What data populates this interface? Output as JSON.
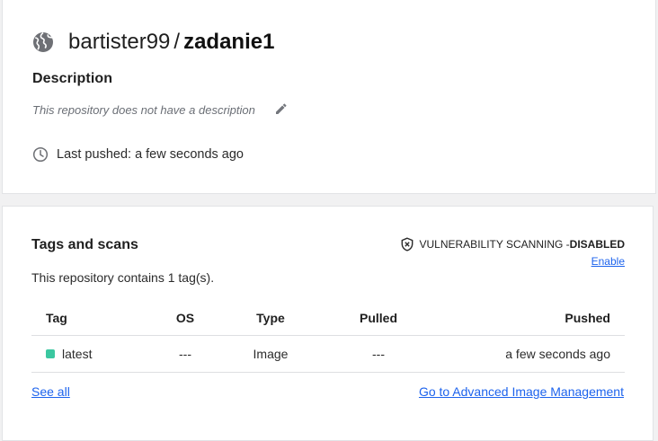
{
  "repo": {
    "owner": "bartister99",
    "separator": "/",
    "name": "zadanie1",
    "icon": "globe-icon"
  },
  "description": {
    "heading": "Description",
    "text": "This repository does not have a description",
    "edit_icon": "pencil-icon"
  },
  "last_pushed": {
    "text": "Last pushed: a few seconds ago",
    "icon": "clock-icon"
  },
  "tags": {
    "heading": "Tags and scans",
    "summary": "This repository contains 1 tag(s).",
    "vulnerability": {
      "label": "VULNERABILITY SCANNING - ",
      "status": "DISABLED",
      "icon": "shield-x-icon",
      "enable_link": "Enable"
    },
    "columns": [
      "Tag",
      "OS",
      "Type",
      "Pulled",
      "Pushed"
    ],
    "rows": [
      {
        "tag": "latest",
        "os": "---",
        "type": "Image",
        "pulled": "---",
        "pushed": "a few seconds ago",
        "dot_color": "#3bc7a0"
      }
    ],
    "see_all": "See all",
    "advanced": "Go to Advanced Image Management"
  },
  "colors": {
    "link": "#1d63ed",
    "background": "#f1f1f2",
    "card": "#ffffff"
  }
}
